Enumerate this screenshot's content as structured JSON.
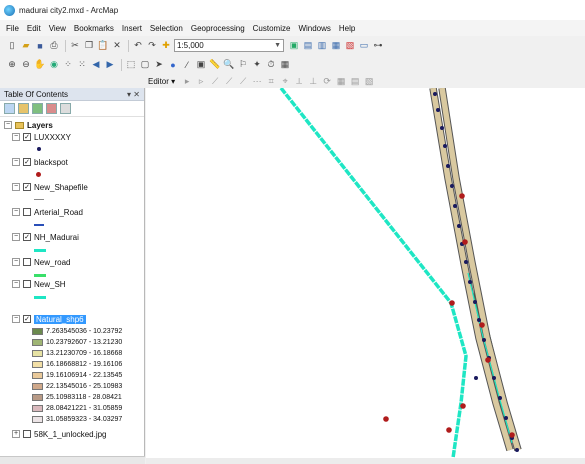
{
  "window": {
    "title": "madurai city2.mxd - ArcMap"
  },
  "menu": [
    "File",
    "Edit",
    "View",
    "Bookmarks",
    "Insert",
    "Selection",
    "Geoprocessing",
    "Customize",
    "Windows",
    "Help"
  ],
  "toolbar": {
    "scale": "1:5,000",
    "editor_label": "Editor ▾"
  },
  "toc": {
    "title": "Table Of Contents",
    "controls": "▾ ✕",
    "group": "Layers",
    "layers": [
      {
        "name": "LUXXXXY",
        "checked": true,
        "symbol": "dot-black"
      },
      {
        "name": "blackspot",
        "checked": true,
        "symbol": "dot-red"
      },
      {
        "name": "New_Shapefile",
        "checked": true,
        "symbol": "line-grey"
      },
      {
        "name": "Arterial_Road",
        "checked": false,
        "symbol": "line-blue"
      },
      {
        "name": "NH_Madurai",
        "checked": true,
        "symbol": "line-cyan"
      },
      {
        "name": "New_road",
        "checked": false,
        "symbol": "line-green"
      },
      {
        "name": "New_SH",
        "checked": false,
        "symbol": "line-cyan"
      },
      {
        "name": "Natural_shp6",
        "checked": true,
        "symbol": "none"
      },
      {
        "name": "58K_1_unlocked.jpg",
        "checked": false,
        "symbol": "none"
      }
    ],
    "legend": [
      {
        "label": "7.263545036 - 10.23792",
        "color": "#6b8a4e"
      },
      {
        "label": "10.23792607 - 13.21230",
        "color": "#9fb574"
      },
      {
        "label": "13.21230709 - 16.18668",
        "color": "#e6e2a3"
      },
      {
        "label": "16.18668812 - 19.16106",
        "color": "#f2dfa6"
      },
      {
        "label": "19.16106914 - 22.13545",
        "color": "#e9c99a"
      },
      {
        "label": "22.13545016 - 25.10983",
        "color": "#cfa88a"
      },
      {
        "label": "25.10983118 - 28.08421",
        "color": "#b89a86"
      },
      {
        "label": "28.08421221 - 31.05859",
        "color": "#d9b9bd"
      },
      {
        "label": "31.05859323 - 34.03297",
        "color": "#ece4e6"
      }
    ]
  },
  "colors": {
    "road_cyan": "#1ee6c4",
    "road_tan": "#d9c9a0",
    "road_outline": "#555555",
    "spot_red": "#b01c1c",
    "spot_black": "#1a1a5e",
    "polygon_green": "#4f7a3a"
  }
}
